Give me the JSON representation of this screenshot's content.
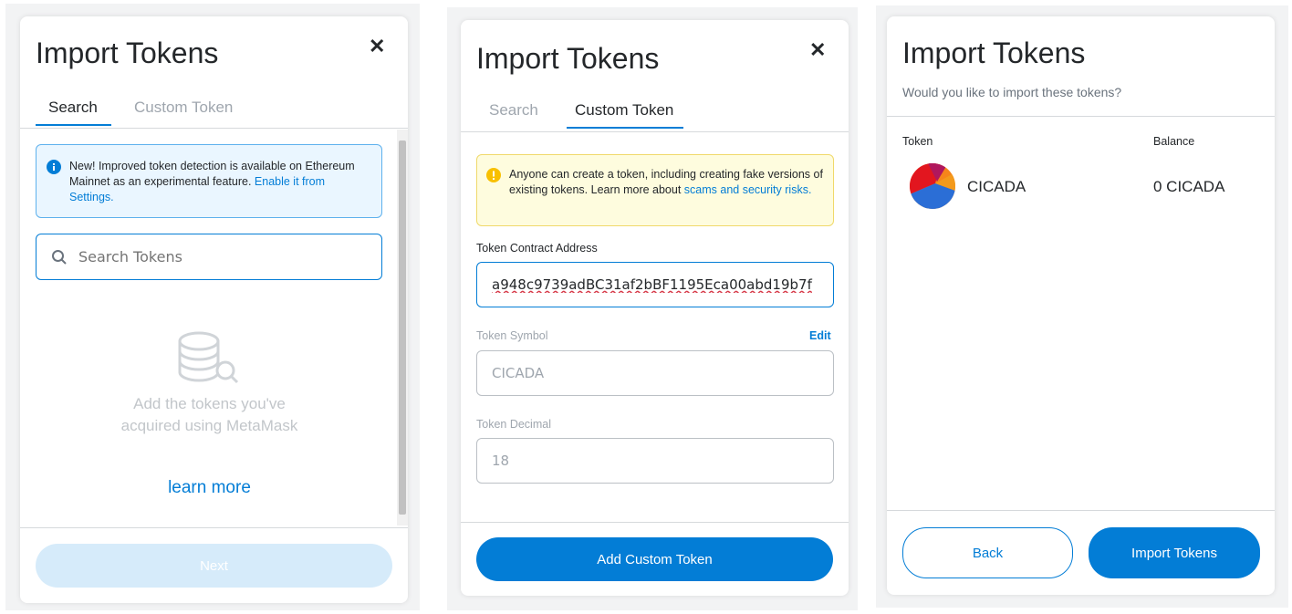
{
  "panel1": {
    "title": "Import Tokens",
    "close_glyph": "✕",
    "tabs": [
      {
        "label": "Search",
        "active": true
      },
      {
        "label": "Custom Token",
        "active": false
      }
    ],
    "info_text": "New! Improved token detection is available on Ethereum Mainnet as an experimental feature.",
    "info_link": "Enable it from Settings.",
    "info_icon": "info-icon",
    "search_placeholder": "Search Tokens",
    "search_value": "",
    "empty_text": "Add the tokens you've acquired using MetaMask",
    "learn_more": "learn more",
    "next_label": "Next"
  },
  "panel2": {
    "title": "Import Tokens",
    "close_glyph": "✕",
    "tabs": [
      {
        "label": "Search",
        "active": false
      },
      {
        "label": "Custom Token",
        "active": true
      }
    ],
    "warning_text": "Anyone can create a token, including creating fake versions of existing tokens. Learn more about",
    "warning_link": "scams and security risks.",
    "address_label": "Token Contract Address",
    "address_value": "a948c9739adBC31af2bBF1195Eca00abd19b7f",
    "symbol_label": "Token Symbol",
    "symbol_edit": "Edit",
    "symbol_value": "CICADA",
    "decimal_label": "Token Decimal",
    "decimal_value": "18",
    "add_button": "Add Custom Token"
  },
  "panel3": {
    "title": "Import Tokens",
    "subtitle": "Would you like to import these tokens?",
    "col_token": "Token",
    "col_balance": "Balance",
    "token_name": "CICADA",
    "token_balance": "0 CICADA",
    "back_button": "Back",
    "import_button": "Import Tokens"
  },
  "colors": {
    "accent": "#037dd6",
    "disabled_button": "#d6ebfa",
    "info_bg": "#eaf6ff",
    "warn_bg": "#fefcde",
    "warn_icon": "#f8c000"
  }
}
